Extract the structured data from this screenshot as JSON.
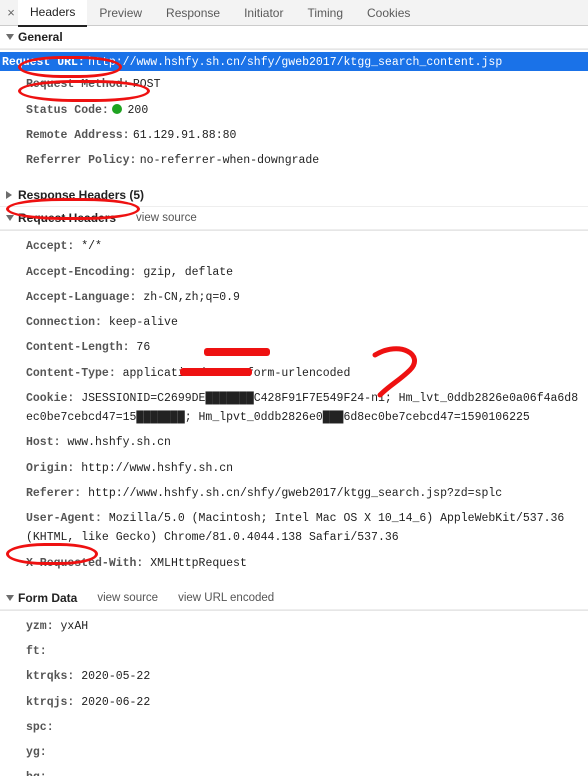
{
  "tabs": {
    "items": [
      {
        "label": "Headers",
        "active": true
      },
      {
        "label": "Preview",
        "active": false
      },
      {
        "label": "Response",
        "active": false
      },
      {
        "label": "Initiator",
        "active": false
      },
      {
        "label": "Timing",
        "active": false
      },
      {
        "label": "Cookies",
        "active": false
      }
    ]
  },
  "sections": {
    "general": {
      "title": "General",
      "rows": [
        {
          "k": "Request URL:",
          "v": "http://www.hshfy.sh.cn/shfy/gweb2017/ktgg_search_content.jsp",
          "hilite": true
        },
        {
          "k": "Request Method:",
          "v": "POST"
        },
        {
          "k": "Status Code:",
          "v": "200",
          "status": true
        },
        {
          "k": "Remote Address:",
          "v": "61.129.91.88:80"
        },
        {
          "k": "Referrer Policy:",
          "v": "no-referrer-when-downgrade"
        }
      ]
    },
    "resphdr": {
      "title": "Response Headers (5)"
    },
    "reqhdr": {
      "title": "Request Headers",
      "viewsource": "view source",
      "rows": [
        {
          "k": "Accept:",
          "v": "*/*"
        },
        {
          "k": "Accept-Encoding:",
          "v": "gzip, deflate"
        },
        {
          "k": "Accept-Language:",
          "v": "zh-CN,zh;q=0.9"
        },
        {
          "k": "Connection:",
          "v": "keep-alive"
        },
        {
          "k": "Content-Length:",
          "v": "76"
        },
        {
          "k": "Content-Type:",
          "v": "application/x-www-form-urlencoded"
        },
        {
          "k": "Cookie:",
          "v": "JSESSIONID=C2699DE███████C428F91F7E549F24-n1; Hm_lvt_0ddb2826e0a06f4a6d8ec0be7cebcd47=15███████; Hm_lpvt_0ddb2826e0███6d8ec0be7cebcd47=1590106225"
        },
        {
          "k": "Host:",
          "v": "www.hshfy.sh.cn"
        },
        {
          "k": "Origin:",
          "v": "http://www.hshfy.sh.cn"
        },
        {
          "k": "Referer:",
          "v": "http://www.hshfy.sh.cn/shfy/gweb2017/ktgg_search.jsp?zd=splc"
        },
        {
          "k": "User-Agent:",
          "v": "Mozilla/5.0 (Macintosh; Intel Mac OS X 10_14_6) AppleWebKit/537.36 (KHTML, like Gecko) Chrome/81.0.4044.138 Safari/537.36"
        },
        {
          "k": "X-Requested-With:",
          "v": "XMLHttpRequest"
        }
      ]
    },
    "formdata": {
      "title": "Form Data",
      "viewsource": "view source",
      "viewurlenc": "view URL encoded",
      "rows": [
        {
          "k": "yzm:",
          "v": "yxAH"
        },
        {
          "k": "ft:",
          "v": ""
        },
        {
          "k": "ktrqks:",
          "v": "2020-05-22"
        },
        {
          "k": "ktrqjs:",
          "v": "2020-06-22"
        },
        {
          "k": "spc:",
          "v": ""
        },
        {
          "k": "yg:",
          "v": ""
        },
        {
          "k": "bg:",
          "v": ""
        }
      ]
    }
  }
}
